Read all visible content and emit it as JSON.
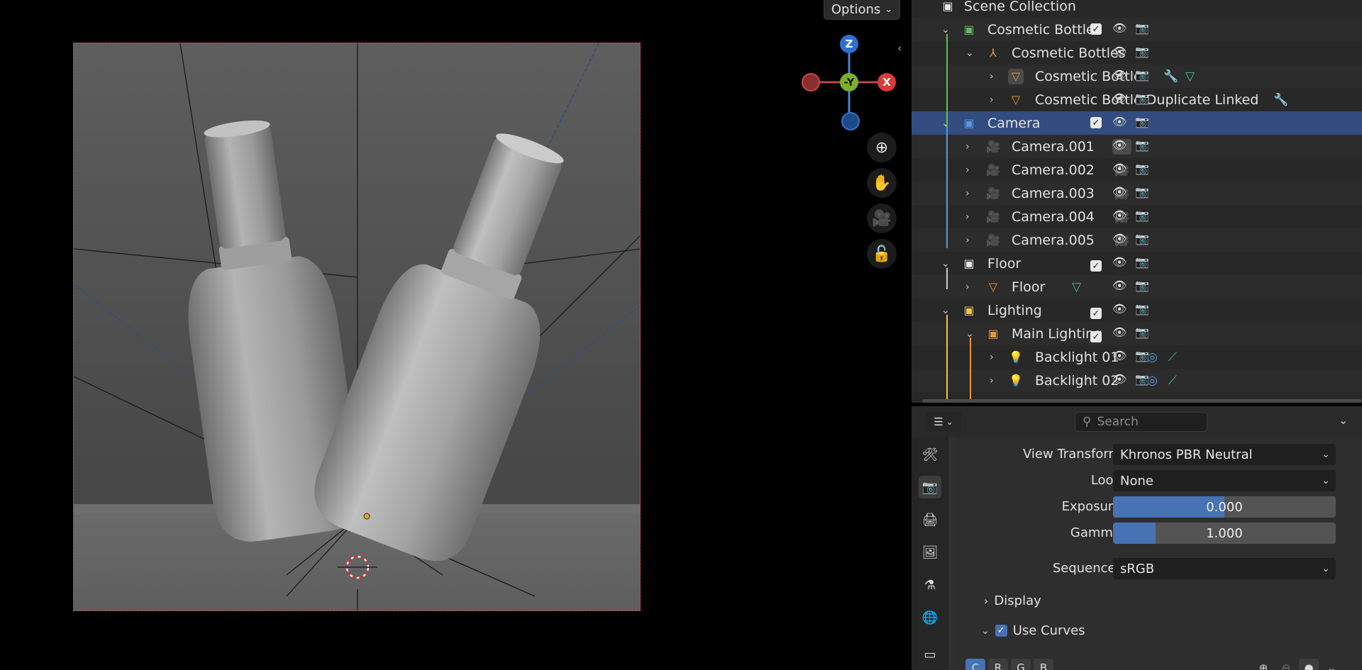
{
  "viewport": {
    "options_label": "Options",
    "gizmo": {
      "z": "Z",
      "y": "-Y",
      "x": "X"
    }
  },
  "outliner": {
    "rows": [
      {
        "label": "Scene Collection"
      },
      {
        "label": "Cosmetic Bottles"
      },
      {
        "label": "Cosmetic Bottles"
      },
      {
        "label": "Cosmetic Bottle"
      },
      {
        "label": "Cosmetic Bottle Duplicate Linked"
      },
      {
        "label": "Camera"
      },
      {
        "label": "Camera.001"
      },
      {
        "label": "Camera.002"
      },
      {
        "label": "Camera.003"
      },
      {
        "label": "Camera.004"
      },
      {
        "label": "Camera.005"
      },
      {
        "label": "Floor"
      },
      {
        "label": "Floor"
      },
      {
        "label": "Lighting"
      },
      {
        "label": "Main Lighting"
      },
      {
        "label": "Backlight 01"
      },
      {
        "label": "Backlight 02"
      }
    ]
  },
  "properties": {
    "search_placeholder": "Search",
    "view_transform_label": "View Transform",
    "view_transform_value": "Khronos PBR Neutral",
    "look_label": "Look",
    "look_value": "None",
    "exposure_label": "Exposure",
    "exposure_value": "0.000",
    "gamma_label": "Gamma",
    "gamma_value": "1.000",
    "sequencer_label": "Sequencer",
    "sequencer_value": "sRGB",
    "display_label": "Display",
    "use_curves_label": "Use Curves",
    "curve_channels": [
      "C",
      "R",
      "G",
      "B"
    ]
  },
  "colors": {
    "selection": "#334d80",
    "accent_blue": "#4772b3",
    "collection_green": "#5fbd5f",
    "collection_blue": "#5a9ae0",
    "collection_yellow": "#e8c84a",
    "object_orange": "#e8953a",
    "data_green": "#3fc48a"
  }
}
